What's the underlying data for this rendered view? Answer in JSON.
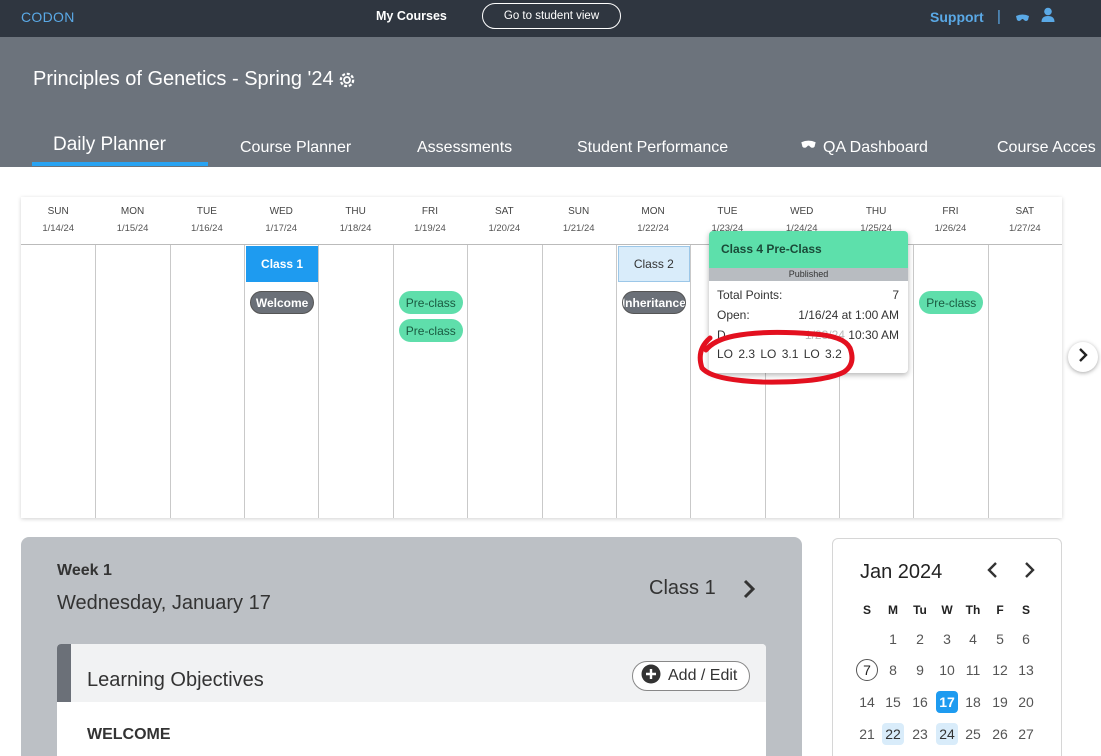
{
  "topbar": {
    "brand": "CODON",
    "my_courses": "My Courses",
    "student_view": "Go to student view",
    "support": "Support",
    "divider": "|",
    "icons": [
      "incognito-mask-icon",
      "user-icon"
    ]
  },
  "header": {
    "course_title": "Principles of Genetics - Spring '24",
    "settings_icon": "gear-icon",
    "tabs": [
      {
        "label": "Daily Planner",
        "active": true
      },
      {
        "label": "Course Planner",
        "active": false
      },
      {
        "label": "Assessments",
        "active": false
      },
      {
        "label": "Student Performance",
        "active": false
      },
      {
        "label": "QA Dashboard",
        "active": false,
        "icon": "incognito-mask-icon"
      },
      {
        "label": "Course Acces",
        "active": false
      }
    ]
  },
  "strip": {
    "days": [
      {
        "name": "SUN",
        "date": "1/14/24"
      },
      {
        "name": "MON",
        "date": "1/15/24"
      },
      {
        "name": "TUE",
        "date": "1/16/24"
      },
      {
        "name": "WED",
        "date": "1/17/24"
      },
      {
        "name": "THU",
        "date": "1/18/24"
      },
      {
        "name": "FRI",
        "date": "1/19/24"
      },
      {
        "name": "SAT",
        "date": "1/20/24"
      },
      {
        "name": "SUN",
        "date": "1/21/24"
      },
      {
        "name": "MON",
        "date": "1/22/24"
      },
      {
        "name": "TUE",
        "date": "1/23/24"
      },
      {
        "name": "WED",
        "date": "1/24/24"
      },
      {
        "name": "THU",
        "date": "1/25/24"
      },
      {
        "name": "FRI",
        "date": "1/26/24"
      },
      {
        "name": "SAT",
        "date": "1/27/24"
      }
    ],
    "class1": "Class 1",
    "class2": "Class 2",
    "welcome": "Welcome",
    "inheritance": "Inheritance",
    "preclass": "Pre-class"
  },
  "popover": {
    "title": "Class 4 Pre-Class",
    "status": "Published",
    "total_points_label": "Total Points:",
    "total_points": "7",
    "open_label": "Open:",
    "open_value": "1/16/24 at 1:00 AM",
    "due_label": "D",
    "due_value_partial": "1/23/24",
    "due_time": "10:30 AM",
    "los": "LO 2.3   LO 3.1   LO 3.2"
  },
  "week": {
    "label": "Week 1",
    "date": "Wednesday, January 17",
    "class_link": "Class 1",
    "lo_title": "Learning Objectives",
    "add_edit": "Add / Edit",
    "first_lo": "WELCOME"
  },
  "minical": {
    "title": "Jan 2024",
    "dow": [
      "S",
      "M",
      "Tu",
      "W",
      "Th",
      "F",
      "S"
    ],
    "row1": [
      "",
      "1",
      "2",
      "3",
      "4",
      "5",
      "6"
    ],
    "row2": [
      "7",
      "8",
      "9",
      "10",
      "11",
      "12",
      "13"
    ],
    "row3": [
      "14",
      "15",
      "16",
      "17",
      "18",
      "19",
      "20"
    ],
    "row4": [
      "21",
      "22",
      "23",
      "24",
      "25",
      "26",
      "27"
    ],
    "selected_day": "17",
    "today": "7",
    "highlighted_days": [
      "22",
      "24"
    ]
  },
  "colors": {
    "navbar": "#2f3640",
    "header": "#6c737c",
    "accent_blue": "#1e9bf0",
    "green": "#5fdeab",
    "annotation_red": "#e3101f"
  }
}
